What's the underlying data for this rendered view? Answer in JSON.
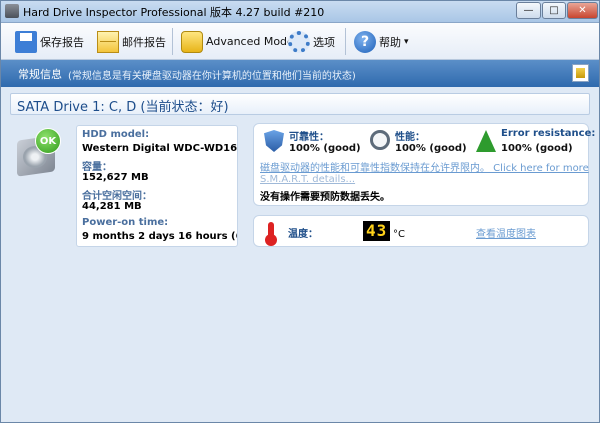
{
  "window": {
    "title": "Hard Drive Inspector Professional 版本 4.27 build #210",
    "controls": {
      "minimize": "—",
      "maximize": "□",
      "close": "✕"
    }
  },
  "toolbar": {
    "save_report": "保存报告",
    "mail_report": "邮件报告",
    "advanced_mode": "Advanced Mode",
    "options": "选项",
    "help": "帮助",
    "help_arrow": "▾",
    "icons": [
      "save-icon",
      "mail-icon",
      "advanced-mode-icon",
      "gear-icon",
      "help-icon"
    ]
  },
  "infobar": {
    "title": "常规信息",
    "description": "(常规信息是有关硬盘驱动器在你计算机的位置和他们当前的状态)"
  },
  "drive": {
    "title": "SATA Drive 1: C, D (当前状态：好)",
    "badge": "OK",
    "props": {
      "model_label": "HDD model:",
      "model_value": "Western Digital WDC-WD16...",
      "capacity_label": "容量：",
      "capacity_value": "152,627 MB",
      "free_label": "合计空闲空间：",
      "free_value": "44,281 MB",
      "poweron_label": "Power-on time:",
      "poweron_value": "9 months 2 days 16 hours (6,..."
    }
  },
  "status": {
    "reliability_label": "可靠性：",
    "reliability_value": "100% (good)",
    "performance_label": "性能：",
    "performance_value": "100% (good)",
    "error_label": "Error resistance:",
    "error_value": "100% (good)",
    "link_text": "磁盘驱动器的性能和可靠性指数保持在允许界限内。 Click here for more",
    "smart_link": "S.M.A.R.T. details...",
    "note": "没有操作需要预防数据丢失。"
  },
  "temperature": {
    "label": "温度：",
    "value": "43",
    "unit": "°C",
    "chart_link": "查看温度图表"
  }
}
